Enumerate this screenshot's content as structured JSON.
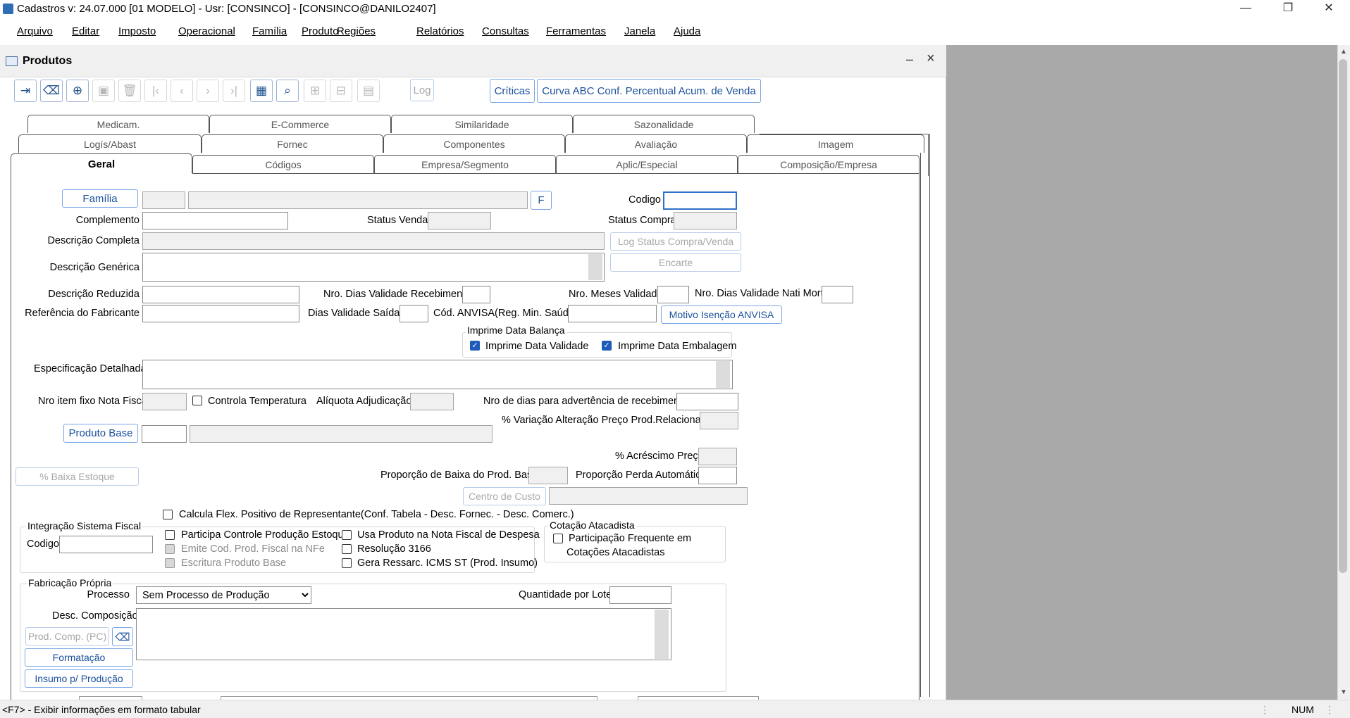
{
  "window": {
    "title": "Cadastros  v: 24.07.000   [01 MODELO] - Usr: [CONSINCO] - [CONSINCO@DANILO2407]",
    "controls": {
      "minimize": "—",
      "restore": "❐",
      "close": "✕"
    }
  },
  "menu": [
    "Arquivo",
    "Editar",
    "Imposto",
    "Operacional",
    "Família",
    "Produto",
    "Regiões",
    "Relatórios",
    "Consultas",
    "Ferramentas",
    "Janela",
    "Ajuda"
  ],
  "child_window": {
    "title": "Produtos",
    "minimize": "–",
    "close": "×"
  },
  "toolbar": {
    "log_label": "Log",
    "criticas_label": "Críticas",
    "curva_label": "Curva ABC Conf. Percentual Acum. de Venda"
  },
  "tabs": {
    "row1": [
      "Medicam.",
      "E-Commerce",
      "Similaridade",
      "Sazonalidade"
    ],
    "row2": [
      "Logís/Abast",
      "Fornec",
      "Componentes",
      "Avaliação",
      "Imagem"
    ],
    "row3": [
      "Geral",
      "Códigos",
      "Empresa/Segmento",
      "Aplic/Especial",
      "Composição/Empresa"
    ],
    "active": "Geral"
  },
  "form": {
    "familia_btn": "Família",
    "f_btn": "F",
    "codigo": "Codigo",
    "complemento": "Complemento",
    "status_venda": "Status Venda",
    "status_compra": "Status Compra",
    "descricao_completa": "Descrição Completa",
    "log_status_btn": "Log Status Compra/Venda",
    "descricao_generica": "Descrição Genérica",
    "encarte_btn": "Encarte",
    "descricao_reduzida": "Descrição Reduzida",
    "nro_dias_validade_receb": "Nro. Dias Validade Recebimento",
    "nro_meses_validade": "Nro. Meses Validade",
    "nro_dias_nati_morto": "Nro. Dias Validade Nati Morto",
    "referencia_fabricante": "Referência do Fabricante",
    "dias_validade_saidas": "Dias Validade Saídas",
    "cod_anvisa": "Cód. ANVISA(Reg. Min. Saúde)",
    "motivo_isencao_btn": "Motivo Isenção ANVISA",
    "imprime_group": "Imprime Data Balança",
    "imprime_validade": "Imprime Data Validade",
    "imprime_embalagem": "Imprime Data Embalagem",
    "especificacao": "Especificação Detalhada",
    "nro_item_fixo": "Nro item fixo Nota Fiscal",
    "controla_temp": "Controla Temperatura",
    "aliquota_adj": "Alíquota Adjudicação",
    "nro_dias_advertencia": "Nro de dias para advertência de recebimento",
    "variacao_preco": "% Variação Alteração Preço Prod.Relacionado",
    "produto_base_btn": "Produto Base",
    "acrescimo_preco": "% Acréscimo Preço",
    "baixa_estoque_btn": "% Baixa Estoque",
    "proporcao_baixa": "Proporção de Baixa do Prod. Base",
    "proporcao_perda": "Proporção Perda Automática",
    "centro_custo_btn": "Centro de Custo",
    "calcula_flex": "Calcula Flex. Positivo de Representante(Conf. Tabela - Desc. Fornec. - Desc. Comerc.)",
    "integracao_group": "Integração Sistema Fiscal",
    "integracao_codigo": "Codigo",
    "participa_controle": "Participa Controle Produção Estoque",
    "emite_cod": "Emite Cod. Prod. Fiscal na NFe",
    "escritura": "Escritura Produto Base",
    "usa_produto": "Usa Produto na Nota Fiscal de Despesa",
    "resolucao": "Resolução 3166",
    "gera_ressarc": "Gera Ressarc. ICMS ST (Prod. Insumo)",
    "cotacao_group": "Cotação Atacadista",
    "participacao_freq_1": "Participação Frequente em",
    "participacao_freq_2": "Cotações Atacadistas",
    "fabricacao_group": "Fabricação Própria",
    "processo": "Processo",
    "processo_value": "Sem Processo de Produção",
    "quantidade_lote": "Quantidade por Lote",
    "desc_composicao": "Desc. Composição",
    "prod_comp_btn": "Prod. Comp. (PC)",
    "formatacao_btn": "Formatação",
    "insumo_btn": "Insumo p/ Produção"
  },
  "status": {
    "hint": "<F7> - Exibir informações em formato tabular",
    "num": "NUM"
  }
}
